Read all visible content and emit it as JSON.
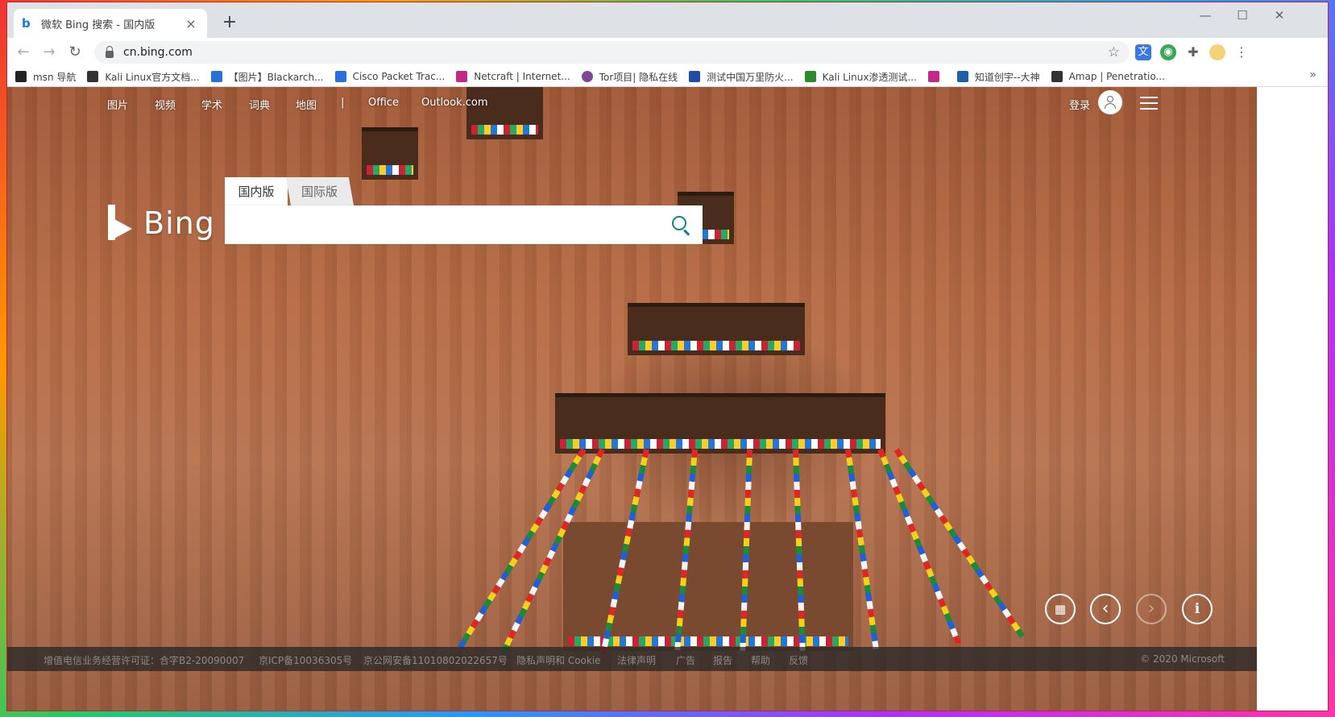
{
  "browser": {
    "tab_title": "微软 Bing 搜索 - 国内版",
    "tab_close": "×",
    "new_tab": "+",
    "url": "cn.bing.com",
    "window_controls": [
      "—",
      "☐",
      "✕"
    ]
  },
  "bookmarks": [
    {
      "label": "msn 导航",
      "icon_color": "#222222"
    },
    {
      "label": "Kali Linux官方文档...",
      "icon_color": "#333333"
    },
    {
      "label": "【图片】Blackarch...",
      "icon_color": "#2d6fd8"
    },
    {
      "label": "Cisco Packet Trac...",
      "icon_color": "#2d6fd8"
    },
    {
      "label": "Netcraft | Internet...",
      "icon_color": "#c22a8a"
    },
    {
      "label": "Tor项目| 隐私在线",
      "icon_color": "#7d4698"
    },
    {
      "label": "测试中国万里防火...",
      "icon_color": "#1f4aa8"
    },
    {
      "label": "Kali Linux渗透测试...",
      "icon_color": "#2c8a2c"
    },
    {
      "label": "",
      "icon_color": "#c22a8a"
    },
    {
      "label": "知道创宇--大神",
      "icon_color": "#1f5fa8"
    },
    {
      "label": "Amap | Penetratio...",
      "icon_color": "#333333"
    }
  ],
  "bing": {
    "nav": [
      "图片",
      "视频",
      "学术",
      "词典",
      "地图",
      "|",
      "Office",
      "Outlook.com"
    ],
    "login": "登录",
    "logo_text": "Bing",
    "scope_tabs": [
      "国内版",
      "国际版"
    ],
    "search_value": "",
    "controls": {
      "qr": "▦",
      "prev": "‹",
      "next": "›",
      "info": "i"
    },
    "footer": [
      "增值电信业务经营许可证：合字B2-20090007",
      "京ICP备10036305号",
      "京公网安备11010802022657号",
      "隐私声明和 Cookie",
      "法律声明",
      "广告",
      "报告",
      "帮助",
      "反馈"
    ],
    "copyright": "© 2020 Microsoft"
  },
  "colors": {
    "accent": "#0c8484",
    "window_border": "#c1272d",
    "tab_strip": "#dee1e6"
  }
}
